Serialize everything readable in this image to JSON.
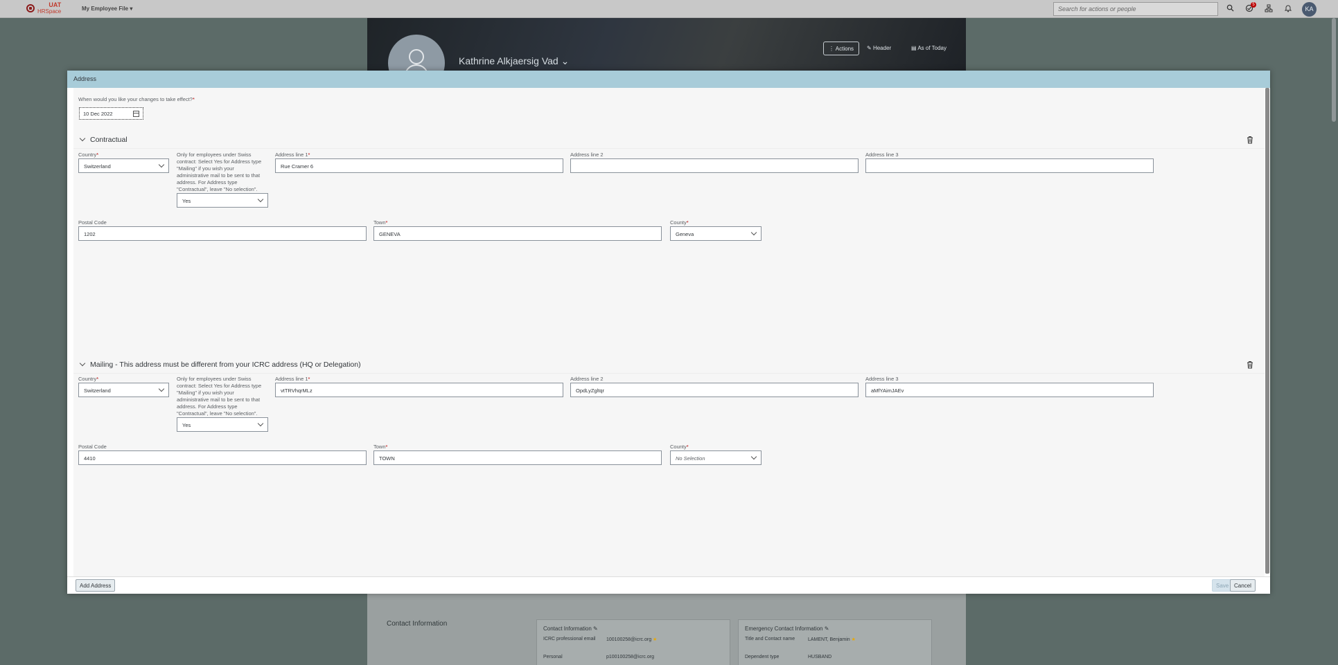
{
  "shell": {
    "logo_line1": "ICRC",
    "logo_uat": "UAT",
    "logo_hr": "HRSpace",
    "menu_label": "My Employee File",
    "search_placeholder": "Search for actions or people",
    "notification_count": "5",
    "avatar_initials": "KA"
  },
  "background": {
    "employee_name": "Kathrine Alkjaersig Vad",
    "header_actions": [
      "Actions",
      "Header",
      "As of Today"
    ],
    "section_title": "Contact Information",
    "contact_card": {
      "title": "Contact Information",
      "rows": [
        {
          "label": "ICRC professional email",
          "value": "100100258@icrc.org"
        },
        {
          "label": "Personal",
          "value": "p100100258@icrc.org"
        }
      ]
    },
    "emergency_card": {
      "title": "Emergency Contact Information",
      "rows": [
        {
          "label": "Title and Contact name",
          "value": "LAMENT, Benjamin"
        },
        {
          "label": "Dependent type",
          "value": "HUSBAND"
        }
      ]
    }
  },
  "dialog": {
    "title": "Address",
    "effective_date_label": "When would you like your changes to take effect?",
    "effective_date_value": "10 Dec 2022",
    "swiss_note": "Only for employees under Swiss contract: Select Yes for Address type \"Mailing\" if you wish your administrative mail to be sent to that address. For Address type \"Contractual\", leave \"No selection\".",
    "labels": {
      "country": "Country",
      "address1": "Address line 1",
      "address2": "Address line 2",
      "address3": "Address line 3",
      "postal": "Postal Code",
      "town": "Town",
      "county": "County"
    },
    "sections": [
      {
        "title": "Contractual",
        "country": "Switzerland",
        "swiss_choice": "Yes",
        "address1": "Rue Cramer 6",
        "address2": "",
        "address3": "",
        "postal": "1202",
        "town": "GENEVA",
        "county": "Geneva"
      },
      {
        "title": "Mailing - This address must be different from your ICRC address (HQ or Delegation)",
        "country": "Switzerland",
        "swiss_choice": "Yes",
        "address1": "vtTRVhqrMLz",
        "address2": "OpdLyZgltqr",
        "address3": "aMfYAimJAEv",
        "postal": "4410",
        "town": "TOWN",
        "county": "No Selection"
      }
    ],
    "add_button": "Add Address",
    "save_button": "Save",
    "cancel_button": "Cancel"
  }
}
